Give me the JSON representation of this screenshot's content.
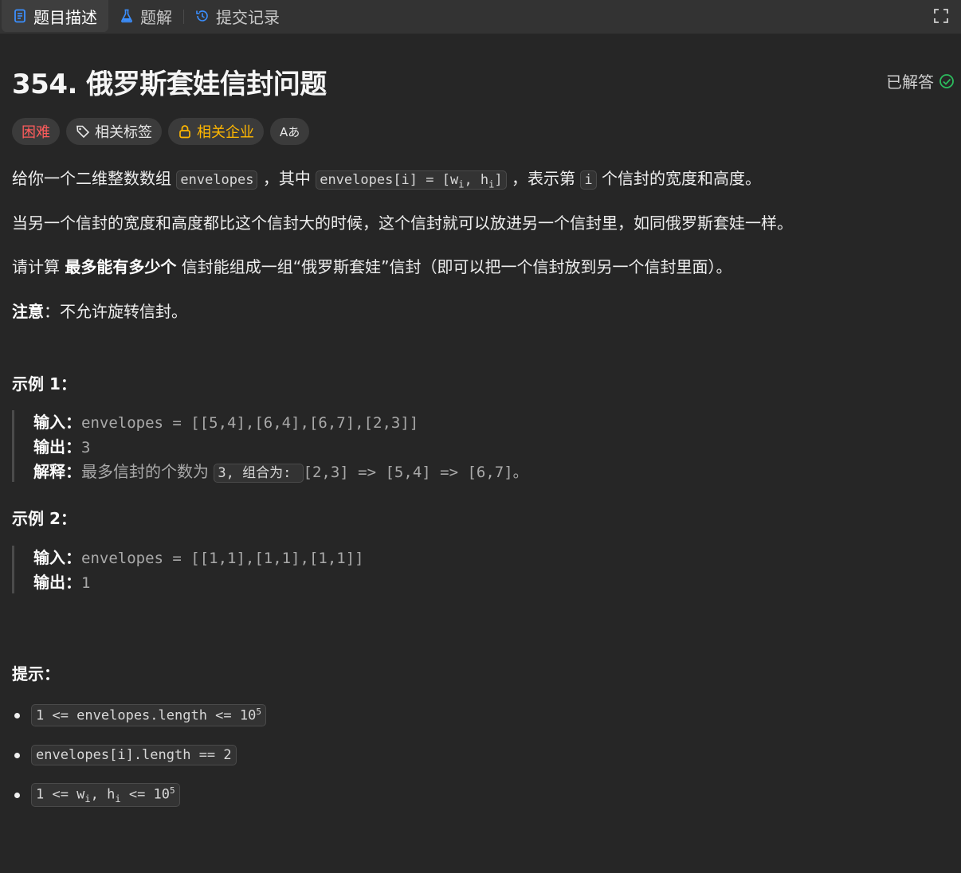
{
  "tabs": [
    {
      "label": "题目描述",
      "icon": "document-icon",
      "active": true
    },
    {
      "label": "题解",
      "icon": "flask-icon",
      "active": false
    },
    {
      "label": "提交记录",
      "icon": "history-icon",
      "active": false
    }
  ],
  "problem": {
    "title": "354. 俄罗斯套娃信封问题",
    "status": "已解答",
    "tags": {
      "difficulty": "困难",
      "related_tags": "相关标签",
      "related_company": "相关企业",
      "translate": "Aあ"
    }
  },
  "description": {
    "p1": {
      "pre": "给你一个二维整数数组 ",
      "code1": "envelopes",
      "mid": " ，其中 ",
      "code2": "envelopes[i] = [w",
      "sub_i1": "i",
      "code2b": ", h",
      "sub_i2": "i",
      "code2c": "]",
      "mid2": " ，表示第 ",
      "code3": "i",
      "post": " 个信封的宽度和高度。"
    },
    "p2": "当另一个信封的宽度和高度都比这个信封大的时候，这个信封就可以放进另一个信封里，如同俄罗斯套娃一样。",
    "p3": {
      "pre": "请计算 ",
      "bold": "最多能有多少个",
      "post": " 信封能组成一组“俄罗斯套娃”信封（即可以把一个信封放到另一个信封里面）。"
    },
    "p4": {
      "bold": "注意",
      "post": "：不允许旋转信封。"
    }
  },
  "examples": [
    {
      "heading": "示例 1：",
      "input_label": "输入：",
      "input": "envelopes = [[5,4],[6,4],[6,7],[2,3]]",
      "output_label": "输出：",
      "output": "3",
      "explain_label": "解释：",
      "explain_pre": "最多信封的个数为 ",
      "explain_code": "3, 组合为: ",
      "explain_post": "[2,3] => [5,4] => [6,7]。"
    },
    {
      "heading": "示例 2：",
      "input_label": "输入：",
      "input": "envelopes = [[1,1],[1,1],[1,1]]",
      "output_label": "输出：",
      "output": "1"
    }
  ],
  "hints": {
    "heading": "提示：",
    "items": [
      {
        "text": "1 <= envelopes.length <= 10",
        "sup": "5"
      },
      {
        "text": "envelopes[i].length == 2",
        "sup": ""
      },
      {
        "pre": "1 <= w",
        "sub1": "i",
        "mid": ", h",
        "sub2": "i",
        "post": " <= 10",
        "sup": "5"
      }
    ]
  },
  "colors": {
    "background": "#262626",
    "tabbar": "#333333",
    "hard": "#ff5c5c",
    "company": "#ffb700",
    "solved_check": "#2cbb5d",
    "tab_icon_blue": "#3b8fff"
  }
}
